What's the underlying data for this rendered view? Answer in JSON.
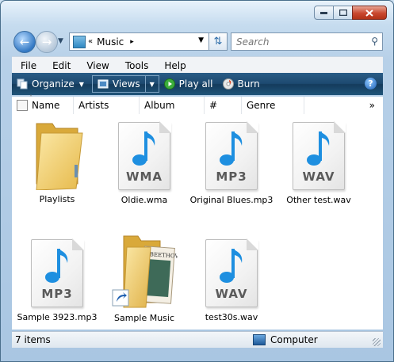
{
  "address": {
    "breadcrumb_chevron": "«",
    "location": "Music",
    "separator": "▸"
  },
  "search": {
    "placeholder": "Search"
  },
  "menu": [
    "File",
    "Edit",
    "View",
    "Tools",
    "Help"
  ],
  "commandbar": {
    "organize": "Organize",
    "views": "Views",
    "play_all": "Play all",
    "burn": "Burn",
    "help": "?"
  },
  "columns": {
    "name": "Name",
    "artists": "Artists",
    "album": "Album",
    "number": "#",
    "genre": "Genre",
    "more": "»"
  },
  "items": [
    {
      "label": "Playlists",
      "kind": "folder",
      "icon": "folder-icon"
    },
    {
      "label": "Oldie.wma",
      "kind": "audio",
      "ext": "WMA",
      "icon": "audio-file-icon"
    },
    {
      "label": "Original Blues.mp3",
      "kind": "audio",
      "ext": "MP3",
      "icon": "audio-file-icon"
    },
    {
      "label": "Other test.wav",
      "kind": "audio",
      "ext": "WAV",
      "icon": "audio-file-icon"
    },
    {
      "label": "Sample 3923.mp3",
      "kind": "audio",
      "ext": "MP3",
      "icon": "audio-file-icon"
    },
    {
      "label": "Sample Music",
      "kind": "shortcut-folder",
      "icon": "folder-shortcut-icon"
    },
    {
      "label": "test30s.wav",
      "kind": "audio",
      "ext": "WAV",
      "icon": "audio-file-icon"
    }
  ],
  "status": {
    "count": "7 items",
    "location": "Computer"
  },
  "colors": {
    "accent": "#1d4a70",
    "note_blue": "#1e8fe0",
    "window_frame": "#b7d0e8"
  }
}
